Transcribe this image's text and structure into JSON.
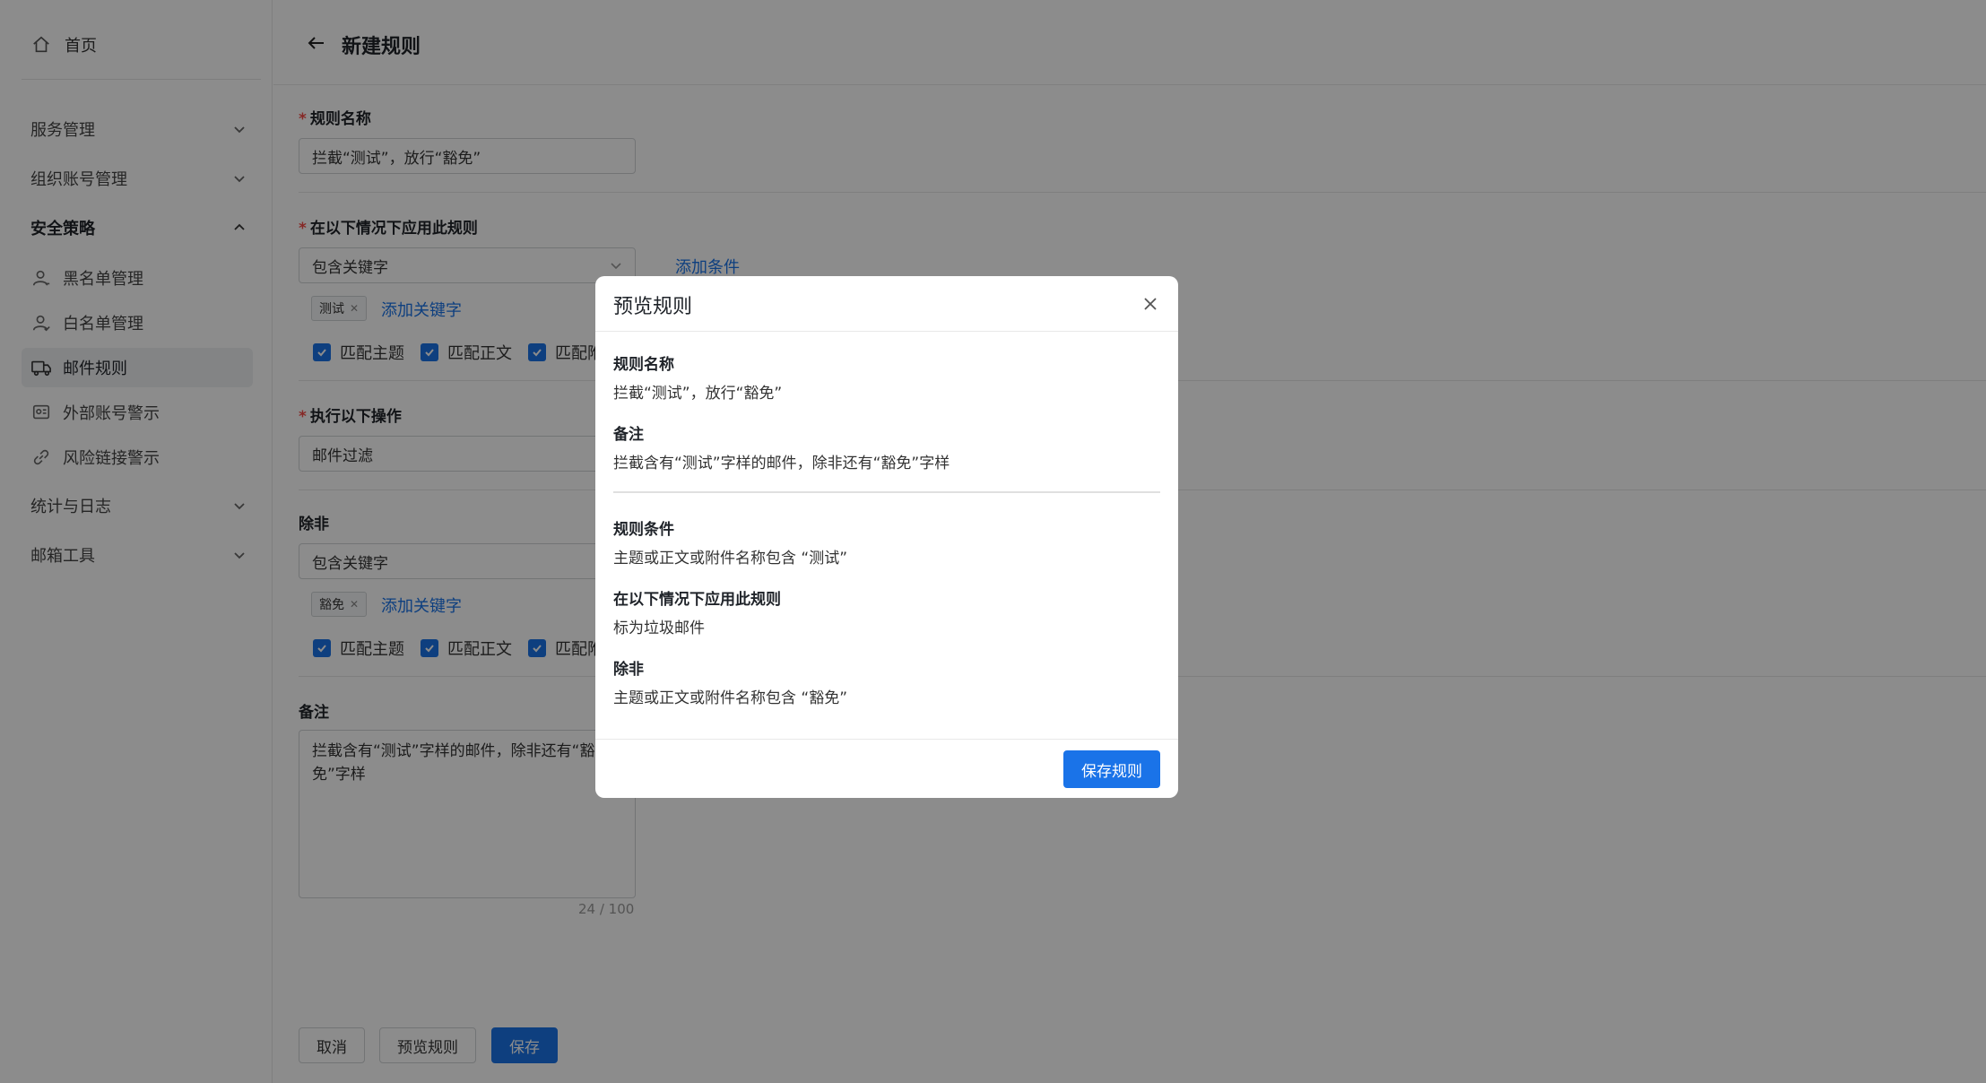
{
  "sidebar": {
    "home": "首页",
    "groups": [
      {
        "label": "服务管理"
      },
      {
        "label": "组织账号管理"
      },
      {
        "label": "安全策略"
      },
      {
        "label": "统计与日志"
      },
      {
        "label": "邮箱工具"
      }
    ],
    "security_items": [
      {
        "label": "黑名单管理",
        "icon": "user-icon"
      },
      {
        "label": "白名单管理",
        "icon": "user-check-icon"
      },
      {
        "label": "邮件规则",
        "icon": "mail-rule-icon"
      },
      {
        "label": "外部账号警示",
        "icon": "external-account-icon"
      },
      {
        "label": "风险链接警示",
        "icon": "link-icon"
      }
    ]
  },
  "header": {
    "title": "新建规则"
  },
  "form": {
    "rule_name": {
      "label": "规则名称",
      "value": "拦截“测试”，放行“豁免”"
    },
    "apply_when": {
      "label": "在以下情况下应用此规则",
      "select_value": "包含关键字",
      "add_condition": "添加条件",
      "tag": "测试",
      "add_keyword": "添加关键字",
      "checks": [
        "匹配主题",
        "匹配正文",
        "匹配附"
      ]
    },
    "action": {
      "label": "执行以下操作",
      "value": "邮件过滤"
    },
    "except": {
      "label": "除非",
      "select_value": "包含关键字",
      "tag": "豁免",
      "add_keyword": "添加关键字",
      "checks": [
        "匹配主题",
        "匹配正文",
        "匹配附"
      ]
    },
    "remark": {
      "label": "备注",
      "value": "拦截含有“测试”字样的邮件，除非还有“豁免”字样",
      "counter": "24 / 100"
    },
    "buttons": {
      "cancel": "取消",
      "preview": "预览规则",
      "save": "保存"
    }
  },
  "modal": {
    "title": "预览规则",
    "rule_name_label": "规则名称",
    "rule_name_value": "拦截“测试”，放行“豁免”",
    "remark_label": "备注",
    "remark_value": "拦截含有“测试”字样的邮件，除非还有“豁免”字样",
    "condition_label": "规则条件",
    "condition_value": "主题或正文或附件名称包含 “测试”",
    "apply_label": "在以下情况下应用此规则",
    "apply_value": "标为垃圾邮件",
    "except_label": "除非",
    "except_value": "主题或正文或附件名称包含 “豁免”",
    "save_button": "保存规则"
  },
  "colors": {
    "primary": "#1a73e8",
    "required": "#f54a45",
    "overlay": "rgba(0,0,0,0.45)"
  }
}
